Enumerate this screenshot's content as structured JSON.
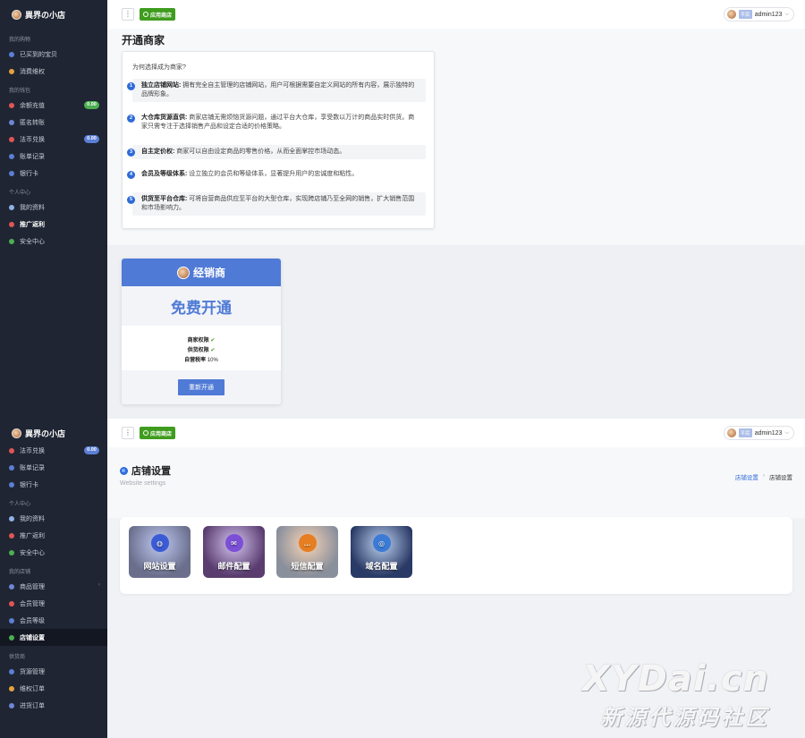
{
  "brand": {
    "name": "異界の小店"
  },
  "topbar": {
    "menu_glyph": "⋮",
    "app_store_label": "应用商店",
    "user_level": "平民",
    "username": "admin123"
  },
  "panel1": {
    "sidebar": [
      {
        "title": "我的购物",
        "items": [
          {
            "label": "已买到的宝贝",
            "color": "#5b7fd6"
          },
          {
            "label": "消费维权",
            "color": "#e6a23c"
          }
        ]
      },
      {
        "title": "我的钱包",
        "items": [
          {
            "label": "余额充值",
            "color": "#e25555",
            "badge": "0.00",
            "badge_color": "green"
          },
          {
            "label": "匿名转账",
            "color": "#6f86d6"
          },
          {
            "label": "法币兑换",
            "color": "#e25555",
            "badge": "0.00",
            "badge_color": "blue"
          },
          {
            "label": "账单记录",
            "color": "#5b7fd6"
          },
          {
            "label": "银行卡",
            "color": "#5b7fd6"
          }
        ]
      },
      {
        "title": "个人中心",
        "items": [
          {
            "label": "我的资料",
            "color": "#8fb2e8"
          },
          {
            "label": "推广返利",
            "color": "#e25555",
            "bold": true
          },
          {
            "label": "安全中心",
            "color": "#4caf50"
          }
        ]
      }
    ],
    "page_title": "开通商家",
    "question": "为何选择成为商家?",
    "reasons": [
      {
        "num": "1",
        "title": "独立店铺网站:",
        "text": "拥有完全自主管理的店铺网站，用户可根据需要自定义网站的所有内容，展示独特的品牌形象。"
      },
      {
        "num": "2",
        "title": "大仓库货源直供:",
        "text": "商家店铺无需烦恼货源问题，通过平台大仓库，享受数以万计的商品实时供货。商家只需专注于选择销售产品和设定合适的价格策略。"
      },
      {
        "num": "3",
        "title": "自主定价权:",
        "text": "商家可以自由设定商品的零售价格，从而全面掌控市场动态。"
      },
      {
        "num": "4",
        "title": "会员及等级体系:",
        "text": "设立独立的会员和等级体系，显著提升用户的忠诚度和粘性。"
      },
      {
        "num": "5",
        "title": "供货至平台仓库:",
        "text": "可将自营商品供应至平台的大型仓库，实现跨店铺乃至全网的销售，扩大销售范围和市场影响力。"
      }
    ],
    "plan": {
      "name": "经销商",
      "price_label": "免费开通",
      "perms": [
        {
          "key": "商家权限",
          "value": "✔"
        },
        {
          "key": "供货权限",
          "value": "✔"
        },
        {
          "key": "自营税率",
          "value": "10%"
        }
      ],
      "button_label": "重新开通"
    }
  },
  "panel2": {
    "sidebar": [
      {
        "title": "",
        "items": [
          {
            "label": "法币兑换",
            "color": "#e25555",
            "badge": "0.00",
            "badge_color": "blue"
          },
          {
            "label": "账单记录",
            "color": "#5b7fd6"
          },
          {
            "label": "银行卡",
            "color": "#5b7fd6"
          }
        ]
      },
      {
        "title": "个人中心",
        "items": [
          {
            "label": "我的资料",
            "color": "#8fb2e8"
          },
          {
            "label": "推广返利",
            "color": "#e25555"
          },
          {
            "label": "安全中心",
            "color": "#4caf50"
          }
        ]
      },
      {
        "title": "我的店铺",
        "items": [
          {
            "label": "商品管理",
            "color": "#6f86d6",
            "chevron": "‹"
          },
          {
            "label": "会员管理",
            "color": "#e25555"
          },
          {
            "label": "会员等级",
            "color": "#5b7fd6"
          },
          {
            "label": "店铺设置",
            "color": "#4caf50",
            "active": true
          }
        ]
      },
      {
        "title": "供货商",
        "items": [
          {
            "label": "货源管理",
            "color": "#5b7fd6"
          },
          {
            "label": "维权订单",
            "color": "#e6a23c"
          },
          {
            "label": "进货订单",
            "color": "#6f86d6"
          }
        ]
      }
    ],
    "page_title": "店铺设置",
    "page_subtitle": "Website settings",
    "breadcrumb": [
      "店铺设置",
      "店铺设置"
    ],
    "breadcrumb_sep": "›",
    "tiles": [
      {
        "label": "网站设置",
        "icon": "globe-icon",
        "bg": "#6b6f8c",
        "icon_bg": "#3b5bd6"
      },
      {
        "label": "邮件配置",
        "icon": "mail-icon",
        "bg": "#5a3c6e",
        "icon_bg": "#7b4fd6"
      },
      {
        "label": "短信配置",
        "icon": "sms-icon",
        "bg": "#8a8f9c",
        "icon_bg": "#e67e22"
      },
      {
        "label": "域名配置",
        "icon": "domain-icon",
        "bg": "#2a3a66",
        "icon_bg": "#3b7bd6"
      }
    ]
  },
  "watermark": {
    "line1": "XYDai.cn",
    "line2": "新源代源码社区"
  }
}
